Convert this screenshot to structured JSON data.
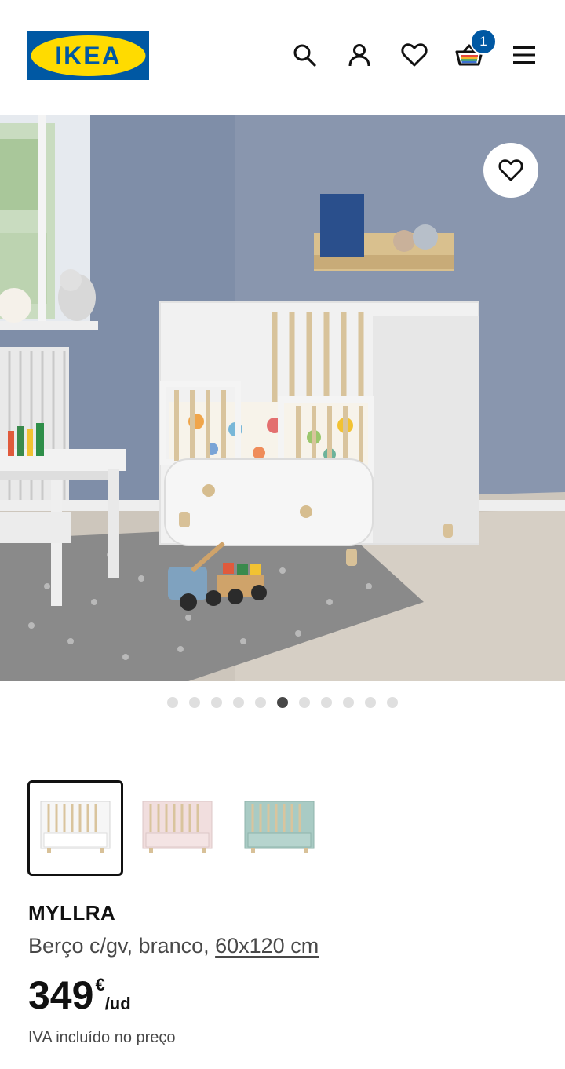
{
  "brand": {
    "logo_text": "IKEA",
    "primary_color": "#0058a3",
    "logo_yellow": "#ffdb00"
  },
  "header": {
    "icons": [
      "search-icon",
      "account-icon",
      "heart-icon",
      "cart-icon",
      "menu-icon"
    ],
    "cart_count": "1"
  },
  "gallery": {
    "image_count": 11,
    "active_index": 5,
    "favourite_icon": "heart-icon"
  },
  "variants": [
    {
      "color": "white",
      "swatch": "#ffffff",
      "selected": true
    },
    {
      "color": "pink",
      "swatch": "#f1dede",
      "selected": false
    },
    {
      "color": "turquoise",
      "swatch": "#a9cbc4",
      "selected": false
    }
  ],
  "product": {
    "name": "MYLLRA",
    "description": "Berço c/gv, branco, ",
    "size": "60x120 cm",
    "price_value": "349",
    "price_currency": "€",
    "price_unit": "/ud",
    "vat_note": "IVA incluído no preço"
  }
}
